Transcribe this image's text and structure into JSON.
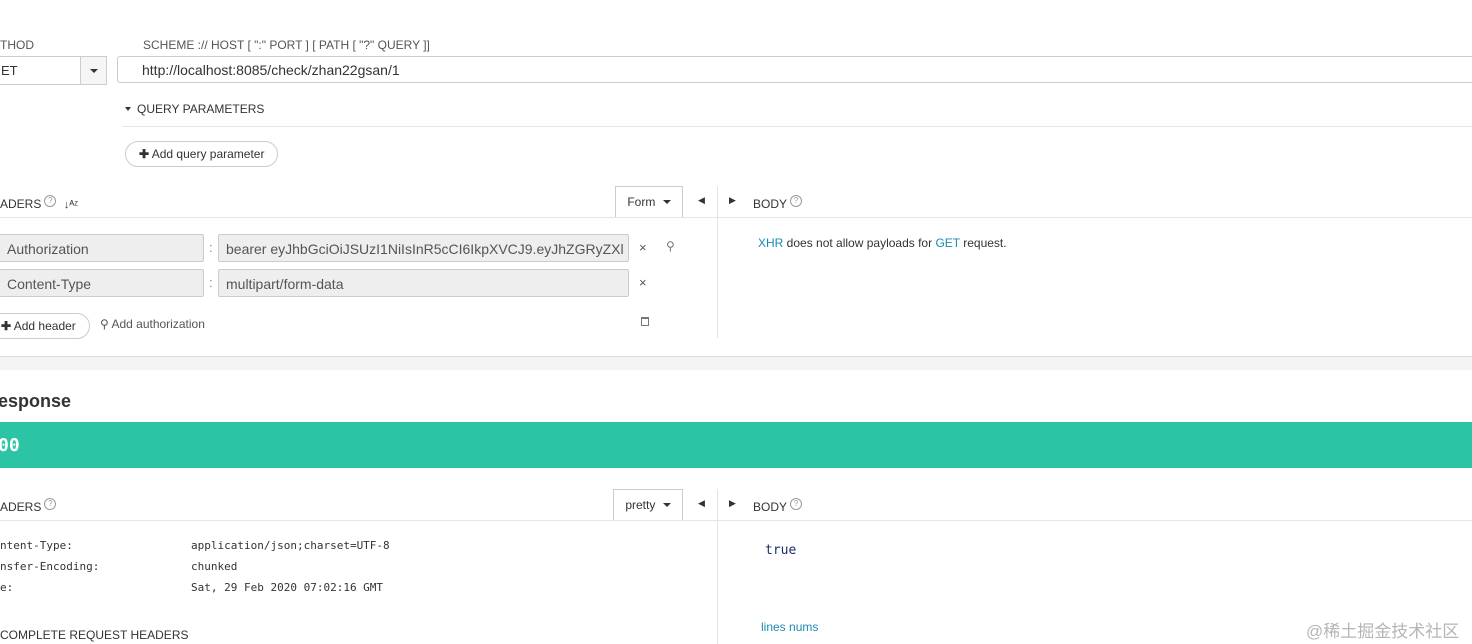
{
  "request": {
    "method_label": "THOD",
    "method_value": "ET",
    "url_label": "SCHEME :// HOST [ \":\" PORT ] [ PATH [ \"?\" QUERY ]]",
    "url_value": "http://localhost:8085/check/zhan22gsan/1",
    "query_params_label": "QUERY PARAMETERS",
    "add_query_param": "Add query parameter",
    "headers_label": "ADERS",
    "sort_icon_text": "↓ᴬᶻ",
    "form_select": "Form",
    "headers": [
      {
        "name": "Authorization",
        "value": "bearer eyJhbGciOiJSUzI1NiIsInR5cCI6IkpXVCJ9.eyJhZGRyZXl"
      },
      {
        "name": "Content-Type",
        "value": "multipart/form-data"
      }
    ],
    "add_header": "Add header",
    "add_authorization": "Add authorization",
    "body_label": "BODY",
    "body_msg": {
      "xhr": "XHR",
      "middle": " does not allow payloads for ",
      "get": "GET",
      "end": " request."
    }
  },
  "response": {
    "title": "esponse",
    "status_code": "00",
    "status_color": "#2bc5a5",
    "headers_label": "ADERS",
    "pretty_select": "pretty",
    "headers": [
      {
        "name": "ntent-Type:",
        "value": "application/json;charset=UTF-8"
      },
      {
        "name": "nsfer-Encoding:",
        "value": "chunked"
      },
      {
        "name": "e:",
        "value": "Sat, 29 Feb 2020 07:02:16 GMT"
      }
    ],
    "complete_request_headers": "COMPLETE REQUEST HEADERS",
    "body_label": "BODY",
    "body_value": "true",
    "lines_nums": "lines nums"
  },
  "watermark": "@稀土掘金技术社区"
}
